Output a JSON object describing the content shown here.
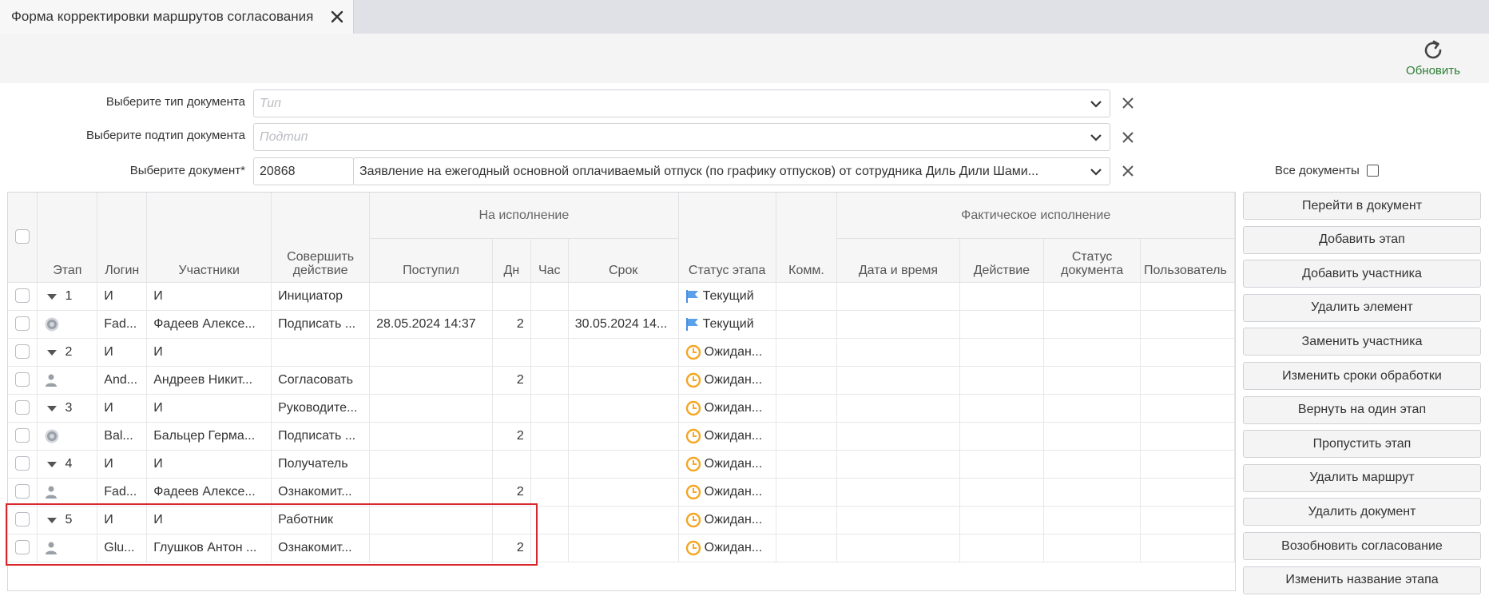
{
  "tab": {
    "title": "Форма корректировки маршрутов согласования"
  },
  "toolbar": {
    "refresh_label": "Обновить"
  },
  "filters": {
    "doc_type": {
      "label": "Выберите тип документа",
      "placeholder": "Тип"
    },
    "doc_subtype": {
      "label": "Выберите подтип документа",
      "placeholder": "Подтип"
    },
    "document": {
      "label": "Выберите документ*",
      "id": "20868",
      "value": "Заявление на ежегодный основной оплачиваемый отпуск (по графику отпусков) от сотрудника Диль Дили Шами..."
    },
    "all_docs_label": "Все документы"
  },
  "grid": {
    "headers": {
      "stage": "Этап",
      "login": "Логин",
      "participants": "Участники",
      "action": "Совершить действие",
      "group_execute": "На исполнение",
      "received": "Поступил",
      "days": "Дн",
      "hours": "Час",
      "deadline": "Срок",
      "stage_status": "Статус этапа",
      "comment": "Комм.",
      "group_actual": "Фактическое исполнение",
      "datetime": "Дата и время",
      "act": "Действие",
      "doc_status": "Статус документа",
      "user": "Пользователь"
    },
    "rows": [
      {
        "kind": "stage",
        "stage": "1",
        "login": "И",
        "participants": "И",
        "action": "Инициатор",
        "received": "",
        "days": "",
        "deadline": "",
        "status": "Текущий",
        "status_type": "current"
      },
      {
        "kind": "member",
        "icon": "gear",
        "login": "Fad...",
        "participants": "Фадеев Алексе...",
        "action": "Подписать ...",
        "received": "28.05.2024 14:37",
        "days": "2",
        "deadline": "30.05.2024 14...",
        "status": "Текущий",
        "status_type": "current"
      },
      {
        "kind": "stage",
        "stage": "2",
        "login": "И",
        "participants": "И",
        "action": "",
        "received": "",
        "days": "",
        "deadline": "",
        "status": "Ожидан...",
        "status_type": "wait"
      },
      {
        "kind": "member",
        "icon": "user",
        "login": "And...",
        "participants": "Андреев Никит...",
        "action": "Согласовать",
        "received": "",
        "days": "2",
        "deadline": "",
        "status": "Ожидан...",
        "status_type": "wait"
      },
      {
        "kind": "stage",
        "stage": "3",
        "login": "И",
        "participants": "И",
        "action": "Руководите...",
        "received": "",
        "days": "",
        "deadline": "",
        "status": "Ожидан...",
        "status_type": "wait"
      },
      {
        "kind": "member",
        "icon": "gear",
        "login": "Bal...",
        "participants": "Бальцер Герма...",
        "action": "Подписать ...",
        "received": "",
        "days": "2",
        "deadline": "",
        "status": "Ожидан...",
        "status_type": "wait"
      },
      {
        "kind": "stage",
        "stage": "4",
        "login": "И",
        "participants": "И",
        "action": "Получатель",
        "received": "",
        "days": "",
        "deadline": "",
        "status": "Ожидан...",
        "status_type": "wait"
      },
      {
        "kind": "member",
        "icon": "user",
        "login": "Fad...",
        "participants": "Фадеев Алексе...",
        "action": "Ознакомит...",
        "received": "",
        "days": "2",
        "deadline": "",
        "status": "Ожидан...",
        "status_type": "wait"
      },
      {
        "kind": "stage",
        "stage": "5",
        "login": "И",
        "participants": "И",
        "action": "Работник",
        "received": "",
        "days": "",
        "deadline": "",
        "status": "Ожидан...",
        "status_type": "wait"
      },
      {
        "kind": "member",
        "icon": "user",
        "login": "Glu...",
        "participants": "Глушков Антон ...",
        "action": "Ознакомит...",
        "received": "",
        "days": "2",
        "deadline": "",
        "status": "Ожидан...",
        "status_type": "wait"
      }
    ]
  },
  "buttons": [
    "Перейти в документ",
    "Добавить этап",
    "Добавить участника",
    "Удалить элемент",
    "Заменить участника",
    "Изменить сроки обработки",
    "Вернуть на один этап",
    "Пропустить этап",
    "Удалить маршрут",
    "Удалить документ",
    "Возобновить согласование",
    "Изменить название этапа"
  ],
  "colors": {
    "flag": "#4a90e2",
    "clock": "#f5a623",
    "highlight": "#d9262c",
    "refresh": "#2e7d32"
  }
}
